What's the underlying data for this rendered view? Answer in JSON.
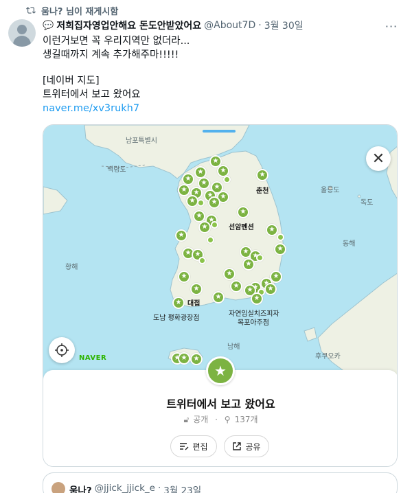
{
  "repost": {
    "text": "움나? 님이 재게시함",
    "icon": "repost-icon"
  },
  "tweet": {
    "emoji": "💬",
    "display_name": "저희집자영업안해요 돈도안받았어요",
    "handle": "@About7D",
    "separator": "·",
    "time": "3월 30일",
    "more_label": "···",
    "lines": [
      "이런거보면 꼭 우리지역만 없더라...",
      "생길때까지 계속 추가해주마!!!!!",
      "[네이버 지도]",
      "트위터에서 보고 왔어요"
    ],
    "link": "naver.me/xv3rukh7"
  },
  "map": {
    "labels": {
      "nampo": "남포특별시",
      "baengnyeong": "백령도",
      "chuncheon": "춘천",
      "ulleung": "울릉도",
      "dokdo": "독도",
      "seonam": "선암펜션",
      "donghae": "동해",
      "hwanghae": "황해",
      "daejeop": "대접",
      "store1": "도남 평화광장점",
      "store2_l1": "자연임실치즈피자",
      "store2_l2": "목포아주점",
      "namhae": "남해",
      "fukuoka": "후쿠오카"
    },
    "brand": "NAVER",
    "close_label": "✕",
    "colors": {
      "sea": "#b4e4f2",
      "land": "#eef1e4",
      "marker": "#7cb342"
    }
  },
  "sheet": {
    "badge": "★",
    "title": "트위터에서 보고 왔어요",
    "visibility": "공개",
    "count": "137개",
    "edit_label": "편집",
    "share_label": "공유"
  },
  "quote": {
    "name": "움나?",
    "handle": "@jjick_jjick_e",
    "separator": "·",
    "time": "3월 23일"
  }
}
